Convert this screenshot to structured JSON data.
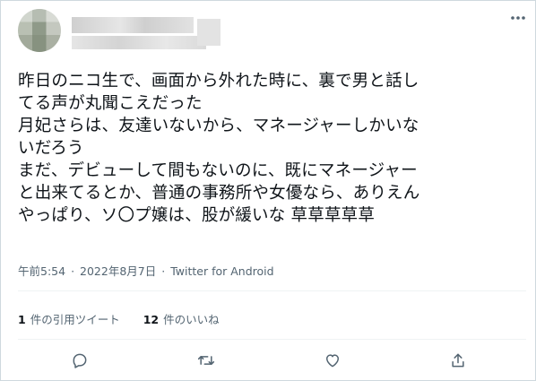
{
  "tweet": {
    "lines": [
      "昨日のニコ生で、画面から外れた時に、裏で男と話し",
      "てる声が丸聞こえだった",
      "月妃さらは、友達いないから、マネージャーしかいな",
      "いだろう",
      "まだ、デビューして間もないのに、既にマネージャー",
      "と出来てるとか、普通の事務所や女優なら、ありえん",
      "やっぱり、ソ〇プ嬢は、股が緩いな 草草草草草"
    ],
    "time": "午前5:54",
    "separator1": "·",
    "date": "2022年8月7日",
    "separator2": "·",
    "client": "Twitter for Android"
  },
  "stats": {
    "quote_count": "1",
    "quote_label": "件の引用ツイート",
    "like_count": "12",
    "like_label": "件のいいね"
  },
  "icons": {
    "more": "more-icon",
    "reply": "reply-icon",
    "retweet": "retweet-icon",
    "like": "heart-icon",
    "share": "share-icon"
  },
  "colors": {
    "text": "#0f1419",
    "secondary": "#536471",
    "border": "#cfd9de",
    "divider": "#eff3f4"
  }
}
